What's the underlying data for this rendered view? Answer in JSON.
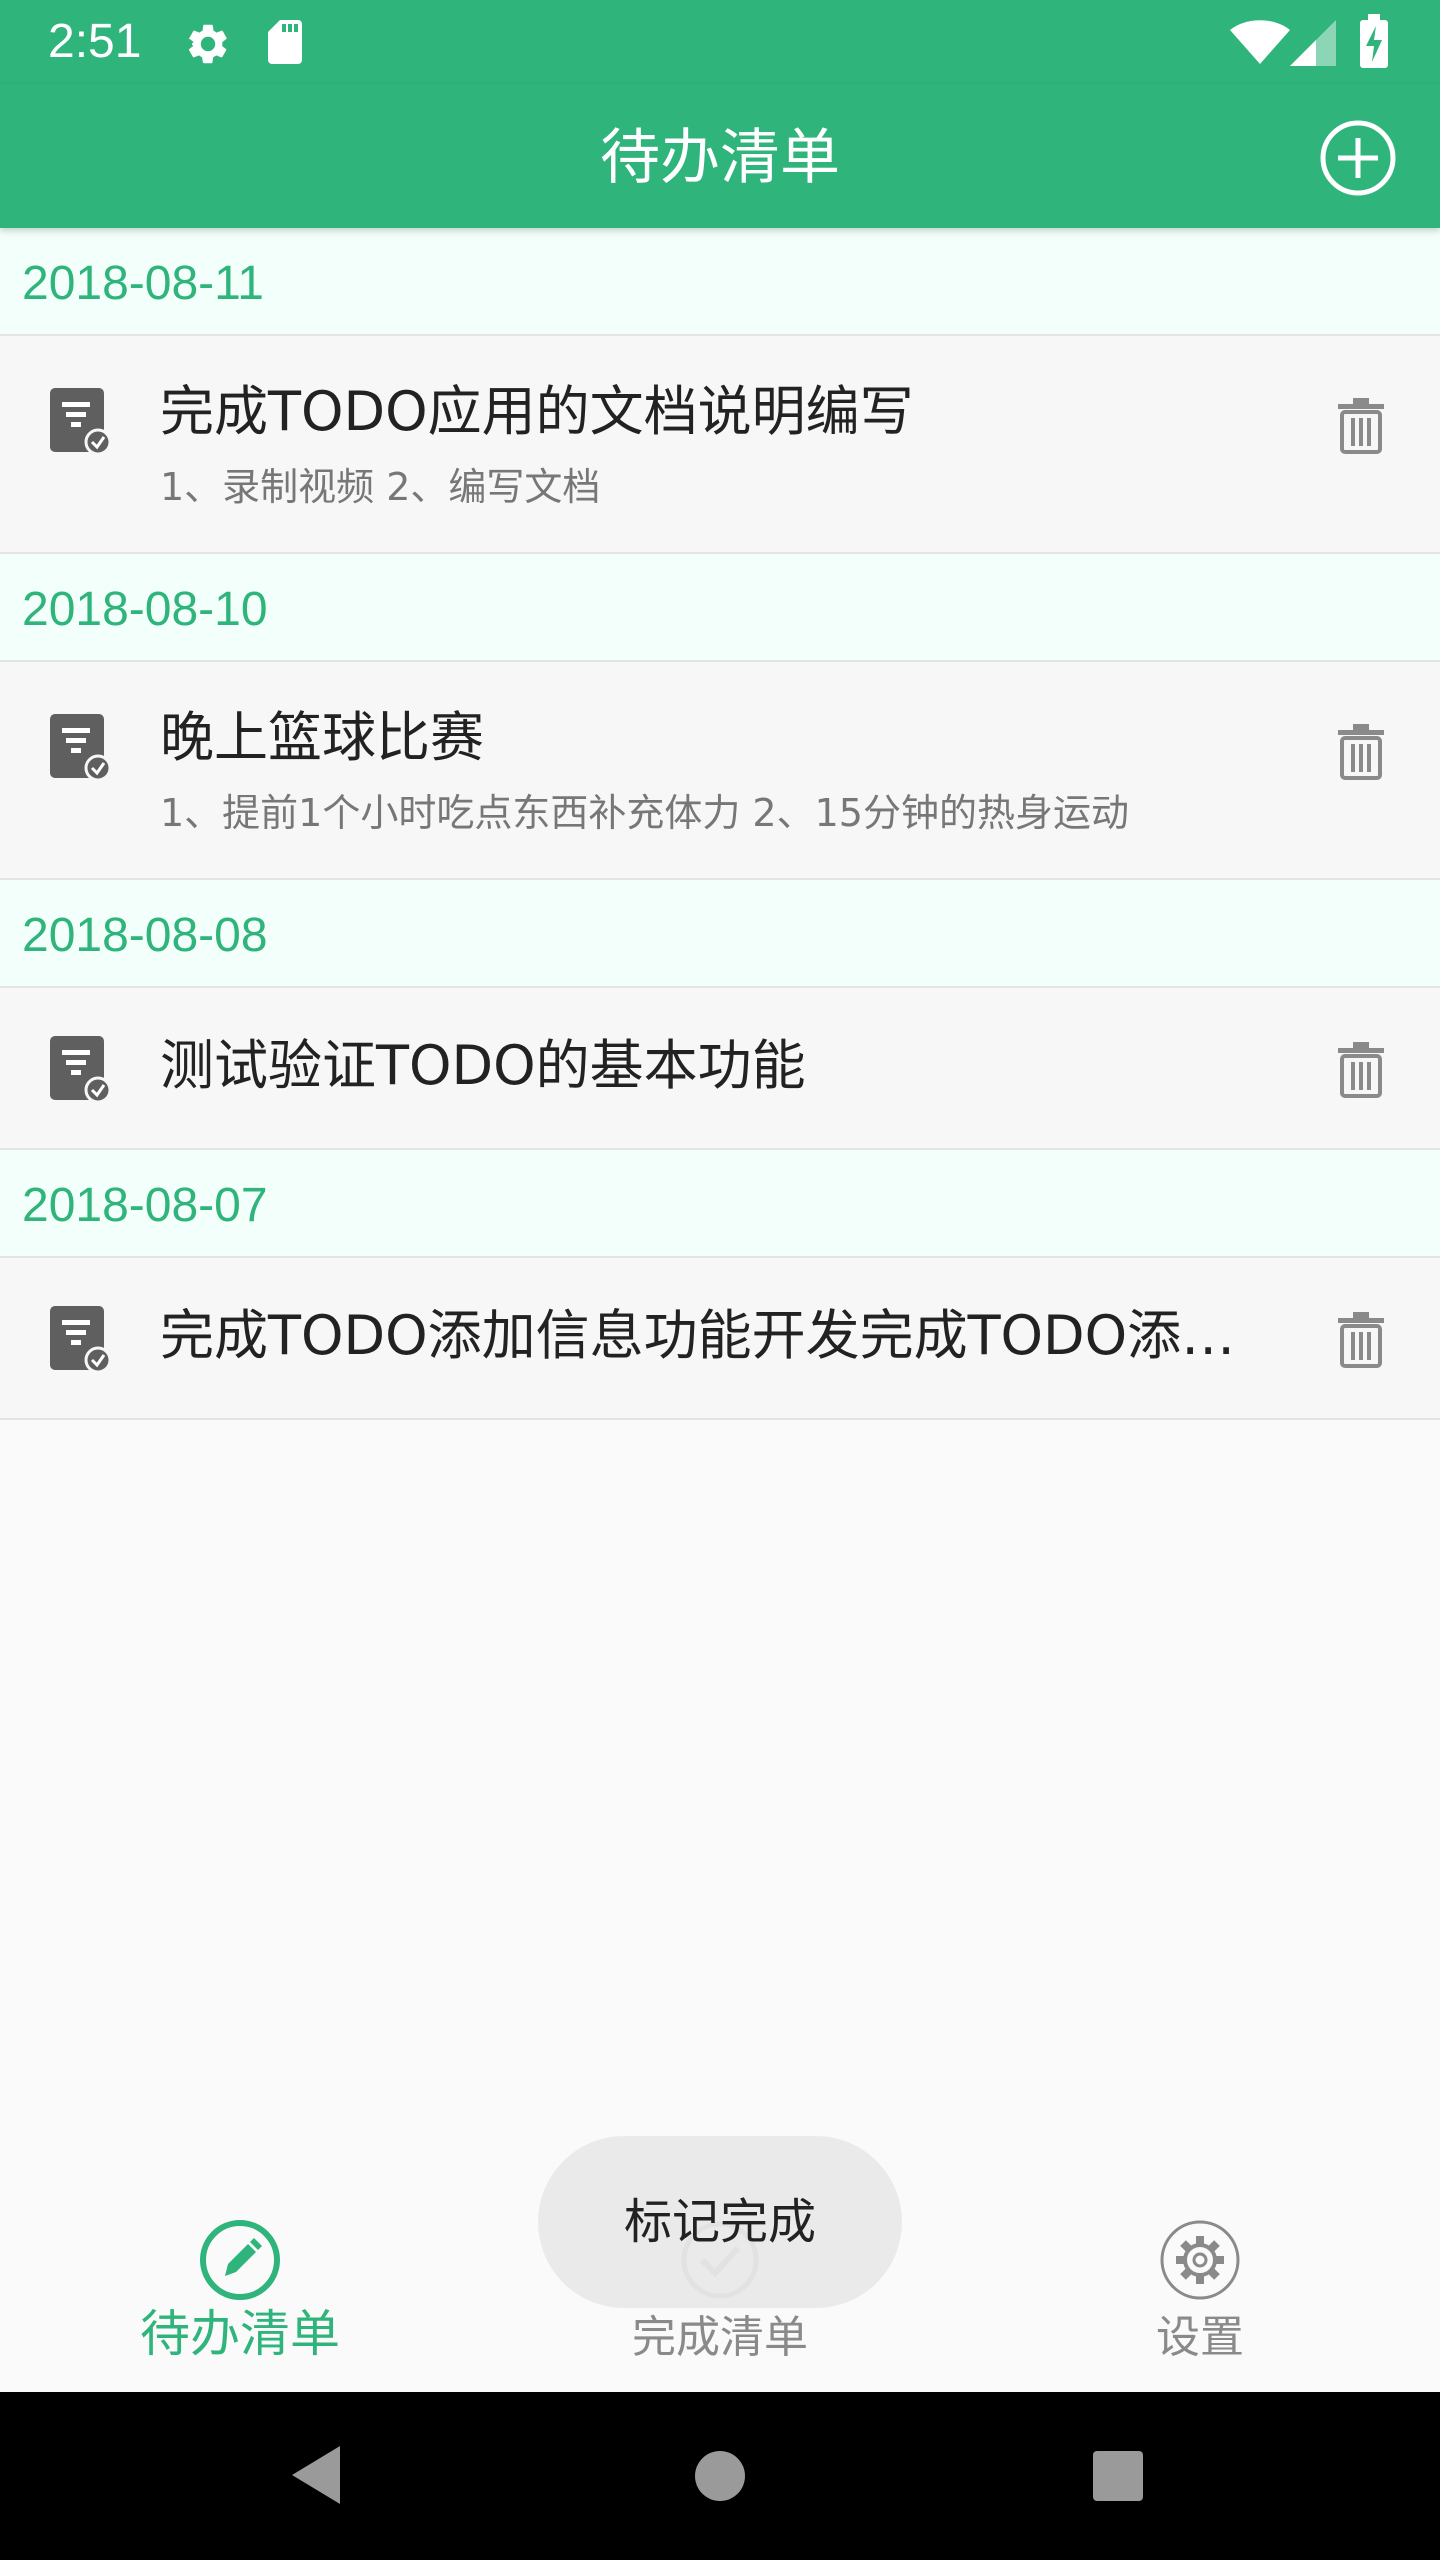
{
  "status_bar": {
    "time": "2:51",
    "icons": [
      "settings-icon",
      "sd-card-icon",
      "wifi-icon",
      "cell-signal-icon",
      "battery-charging-icon"
    ]
  },
  "app_bar": {
    "title": "待办清单",
    "add_icon": "add-circle-icon"
  },
  "colors": {
    "primary": "#2fb47c",
    "date_header_bg": "#f2fffb",
    "item_bg": "#f7f7f7",
    "inactive": "#8a8a8a"
  },
  "groups": [
    {
      "date": "2018-08-11",
      "items": [
        {
          "title": "完成TODO应用的文档说明编写",
          "subtitle": "1、录制视频 2、编写文档"
        }
      ]
    },
    {
      "date": "2018-08-10",
      "items": [
        {
          "title": "晚上篮球比赛",
          "subtitle": "1、提前1个小时吃点东西补充体力 2、15分钟的热身运动"
        }
      ]
    },
    {
      "date": "2018-08-08",
      "items": [
        {
          "title": "测试验证TODO的基本功能",
          "subtitle": ""
        }
      ]
    },
    {
      "date": "2018-08-07",
      "items": [
        {
          "title": "完成TODO添加信息功能开发完成TODO添加…",
          "subtitle": ""
        }
      ]
    }
  ],
  "bottom_nav": {
    "items": [
      {
        "label": "待办清单",
        "icon": "edit-icon",
        "active": true
      },
      {
        "label": "完成清单",
        "icon": "check-circle-icon",
        "active": false
      },
      {
        "label": "设置",
        "icon": "settings-icon",
        "active": false
      }
    ]
  },
  "toast": {
    "text": "标记完成"
  },
  "system_nav": {
    "buttons": [
      "back-icon",
      "home-icon",
      "recents-icon"
    ]
  }
}
